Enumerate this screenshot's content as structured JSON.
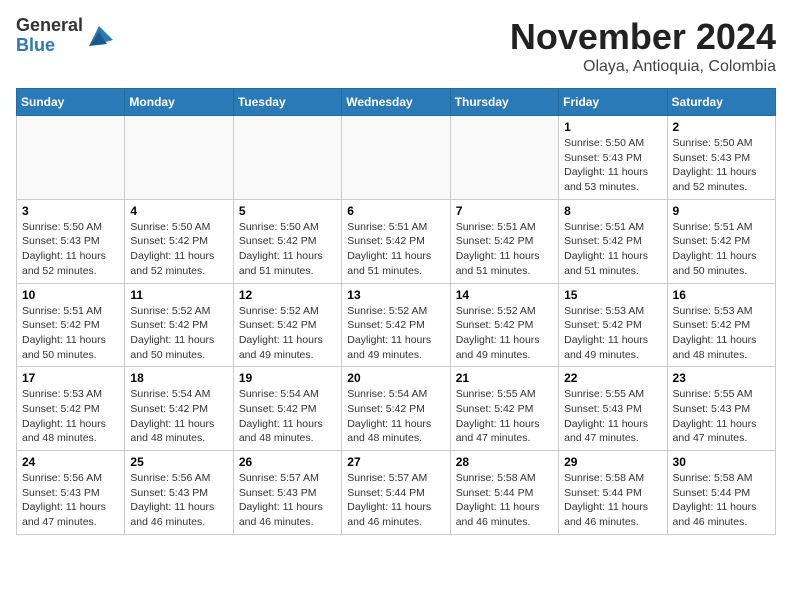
{
  "header": {
    "logo_line1": "General",
    "logo_line2": "Blue",
    "title": "November 2024",
    "subtitle": "Olaya, Antioquia, Colombia"
  },
  "days_of_week": [
    "Sunday",
    "Monday",
    "Tuesday",
    "Wednesday",
    "Thursday",
    "Friday",
    "Saturday"
  ],
  "weeks": [
    [
      {
        "day": "",
        "info": ""
      },
      {
        "day": "",
        "info": ""
      },
      {
        "day": "",
        "info": ""
      },
      {
        "day": "",
        "info": ""
      },
      {
        "day": "",
        "info": ""
      },
      {
        "day": "1",
        "info": "Sunrise: 5:50 AM\nSunset: 5:43 PM\nDaylight: 11 hours\nand 53 minutes."
      },
      {
        "day": "2",
        "info": "Sunrise: 5:50 AM\nSunset: 5:43 PM\nDaylight: 11 hours\nand 52 minutes."
      }
    ],
    [
      {
        "day": "3",
        "info": "Sunrise: 5:50 AM\nSunset: 5:43 PM\nDaylight: 11 hours\nand 52 minutes."
      },
      {
        "day": "4",
        "info": "Sunrise: 5:50 AM\nSunset: 5:42 PM\nDaylight: 11 hours\nand 52 minutes."
      },
      {
        "day": "5",
        "info": "Sunrise: 5:50 AM\nSunset: 5:42 PM\nDaylight: 11 hours\nand 51 minutes."
      },
      {
        "day": "6",
        "info": "Sunrise: 5:51 AM\nSunset: 5:42 PM\nDaylight: 11 hours\nand 51 minutes."
      },
      {
        "day": "7",
        "info": "Sunrise: 5:51 AM\nSunset: 5:42 PM\nDaylight: 11 hours\nand 51 minutes."
      },
      {
        "day": "8",
        "info": "Sunrise: 5:51 AM\nSunset: 5:42 PM\nDaylight: 11 hours\nand 51 minutes."
      },
      {
        "day": "9",
        "info": "Sunrise: 5:51 AM\nSunset: 5:42 PM\nDaylight: 11 hours\nand 50 minutes."
      }
    ],
    [
      {
        "day": "10",
        "info": "Sunrise: 5:51 AM\nSunset: 5:42 PM\nDaylight: 11 hours\nand 50 minutes."
      },
      {
        "day": "11",
        "info": "Sunrise: 5:52 AM\nSunset: 5:42 PM\nDaylight: 11 hours\nand 50 minutes."
      },
      {
        "day": "12",
        "info": "Sunrise: 5:52 AM\nSunset: 5:42 PM\nDaylight: 11 hours\nand 49 minutes."
      },
      {
        "day": "13",
        "info": "Sunrise: 5:52 AM\nSunset: 5:42 PM\nDaylight: 11 hours\nand 49 minutes."
      },
      {
        "day": "14",
        "info": "Sunrise: 5:52 AM\nSunset: 5:42 PM\nDaylight: 11 hours\nand 49 minutes."
      },
      {
        "day": "15",
        "info": "Sunrise: 5:53 AM\nSunset: 5:42 PM\nDaylight: 11 hours\nand 49 minutes."
      },
      {
        "day": "16",
        "info": "Sunrise: 5:53 AM\nSunset: 5:42 PM\nDaylight: 11 hours\nand 48 minutes."
      }
    ],
    [
      {
        "day": "17",
        "info": "Sunrise: 5:53 AM\nSunset: 5:42 PM\nDaylight: 11 hours\nand 48 minutes."
      },
      {
        "day": "18",
        "info": "Sunrise: 5:54 AM\nSunset: 5:42 PM\nDaylight: 11 hours\nand 48 minutes."
      },
      {
        "day": "19",
        "info": "Sunrise: 5:54 AM\nSunset: 5:42 PM\nDaylight: 11 hours\nand 48 minutes."
      },
      {
        "day": "20",
        "info": "Sunrise: 5:54 AM\nSunset: 5:42 PM\nDaylight: 11 hours\nand 48 minutes."
      },
      {
        "day": "21",
        "info": "Sunrise: 5:55 AM\nSunset: 5:42 PM\nDaylight: 11 hours\nand 47 minutes."
      },
      {
        "day": "22",
        "info": "Sunrise: 5:55 AM\nSunset: 5:43 PM\nDaylight: 11 hours\nand 47 minutes."
      },
      {
        "day": "23",
        "info": "Sunrise: 5:55 AM\nSunset: 5:43 PM\nDaylight: 11 hours\nand 47 minutes."
      }
    ],
    [
      {
        "day": "24",
        "info": "Sunrise: 5:56 AM\nSunset: 5:43 PM\nDaylight: 11 hours\nand 47 minutes."
      },
      {
        "day": "25",
        "info": "Sunrise: 5:56 AM\nSunset: 5:43 PM\nDaylight: 11 hours\nand 46 minutes."
      },
      {
        "day": "26",
        "info": "Sunrise: 5:57 AM\nSunset: 5:43 PM\nDaylight: 11 hours\nand 46 minutes."
      },
      {
        "day": "27",
        "info": "Sunrise: 5:57 AM\nSunset: 5:44 PM\nDaylight: 11 hours\nand 46 minutes."
      },
      {
        "day": "28",
        "info": "Sunrise: 5:58 AM\nSunset: 5:44 PM\nDaylight: 11 hours\nand 46 minutes."
      },
      {
        "day": "29",
        "info": "Sunrise: 5:58 AM\nSunset: 5:44 PM\nDaylight: 11 hours\nand 46 minutes."
      },
      {
        "day": "30",
        "info": "Sunrise: 5:58 AM\nSunset: 5:44 PM\nDaylight: 11 hours\nand 46 minutes."
      }
    ]
  ]
}
